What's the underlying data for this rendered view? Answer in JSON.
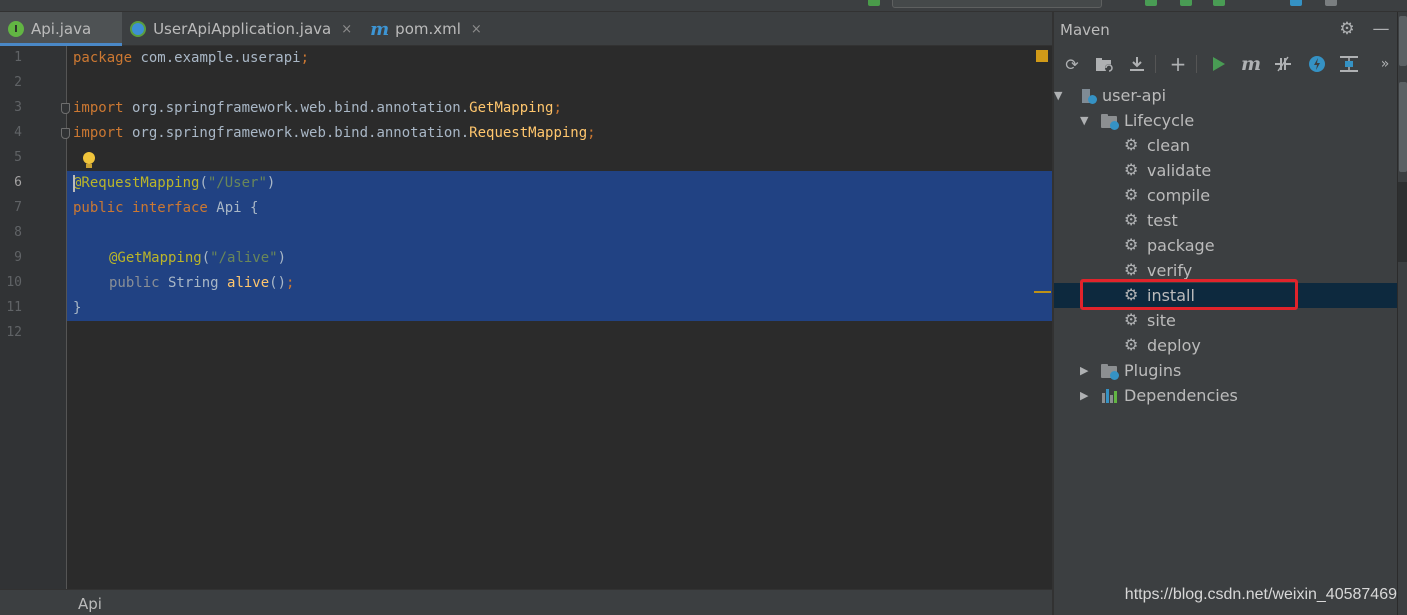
{
  "tabs": [
    {
      "label": "Api.java",
      "icon": "interface-icon",
      "active": true
    },
    {
      "label": "UserApiApplication.java",
      "icon": "spring-class-icon",
      "active": false
    },
    {
      "label": "pom.xml",
      "icon": "maven-m-icon",
      "active": false
    }
  ],
  "tab_close_glyph": "×",
  "editor": {
    "line_numbers": [
      "1",
      "2",
      "3",
      "4",
      "5",
      "6",
      "7",
      "8",
      "9",
      "10",
      "11",
      "12"
    ],
    "current_line": "6",
    "lines": {
      "l1_kw": "package",
      "l1_rest": " com.example.userapi",
      "l1_semi": ";",
      "l3_kw": "import",
      "l3_pkg": " org.springframework.web.bind.annotation.",
      "l3_cls": "GetMapping",
      "l3_semi": ";",
      "l4_kw": "import",
      "l4_pkg": " org.springframework.web.bind.annotation.",
      "l4_cls": "RequestMapping",
      "l4_semi": ";",
      "l6_ann": "@RequestMapping",
      "l6_open": "(",
      "l6_str": "\"/User\"",
      "l6_close": ")",
      "l7_kw1": "public",
      "l7_kw2": " interface",
      "l7_rest": " Api {",
      "l9_ann": "@GetMapping",
      "l9_open": "(",
      "l9_str": "\"/alive\"",
      "l9_close": ")",
      "l10_kw": "public",
      "l10_type": " String ",
      "l10_fn": "alive",
      "l10_paren": "()",
      "l10_semi": ";",
      "l11_brace": "}"
    }
  },
  "breadcrumb": "Api",
  "maven": {
    "title": "Maven",
    "toolbar": [
      "reload-icon",
      "generate-sources-icon",
      "download-icon",
      "add-icon",
      "run-icon",
      "execute-goal-icon",
      "toggle-offline-icon",
      "skip-tests-icon",
      "show-dependencies-icon",
      "more-icon"
    ],
    "tree": {
      "project": "user-api",
      "lifecycle": "Lifecycle",
      "goals": [
        "clean",
        "validate",
        "compile",
        "test",
        "package",
        "verify",
        "install",
        "site",
        "deploy"
      ],
      "selected_goal": "install",
      "plugins": "Plugins",
      "dependencies": "Dependencies"
    }
  },
  "watermark": "https://blog.csdn.net/weixin_40587469",
  "colors": {
    "editor_bg": "#2b2b2b",
    "selection": "#214283",
    "keyword": "#cc7832",
    "annotation": "#bbb529",
    "string": "#6a8759",
    "highlight_box": "#e0232b",
    "selected_row": "#0d293e"
  }
}
